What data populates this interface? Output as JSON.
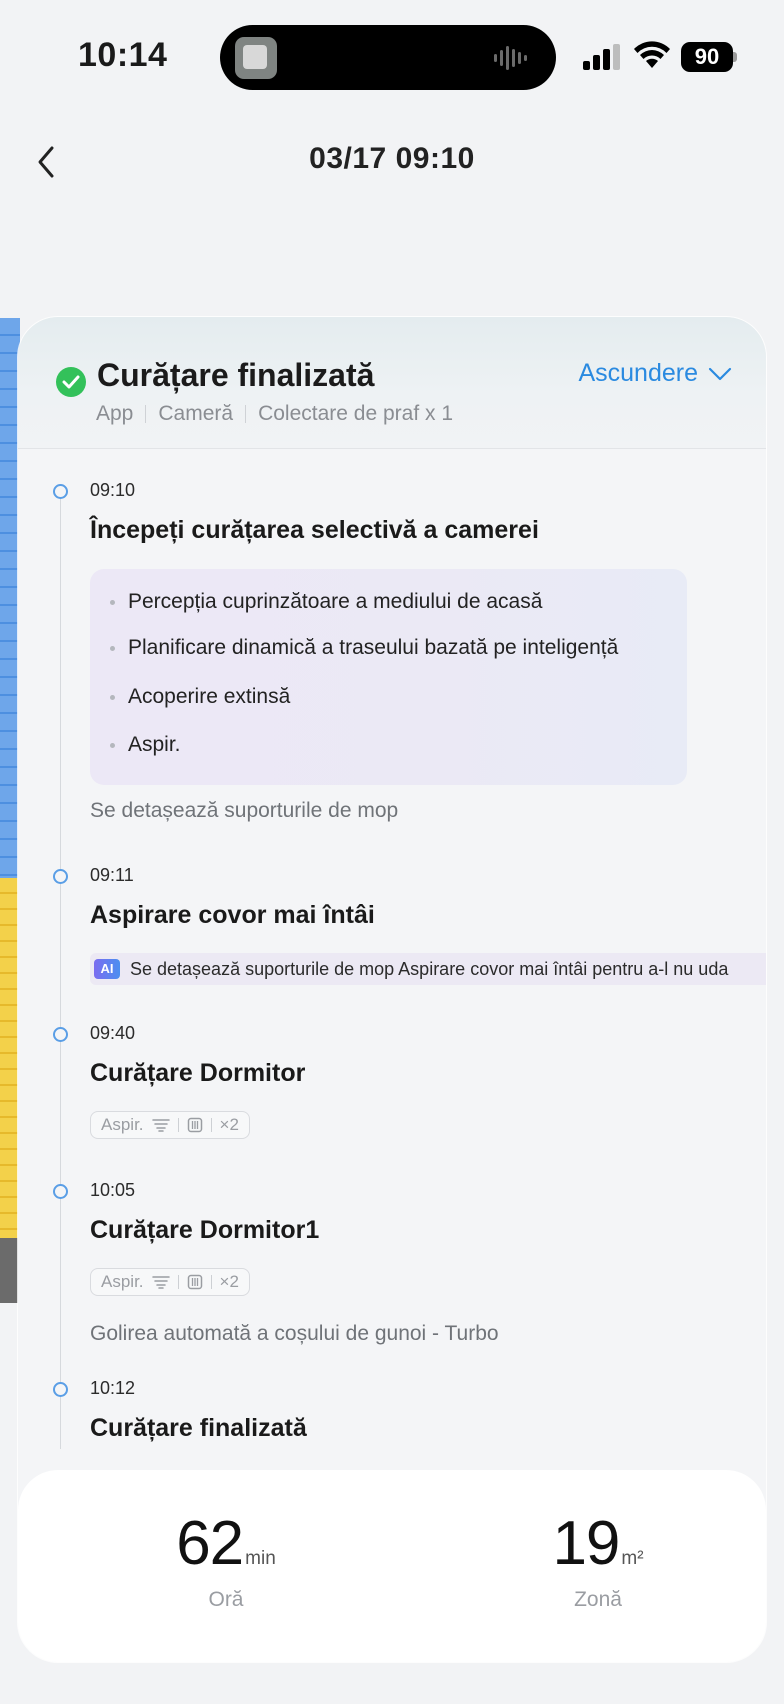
{
  "status_bar": {
    "time": "10:14",
    "battery": "90"
  },
  "nav": {
    "title": "03/17  09:10"
  },
  "summary": {
    "title": "Curățare finalizată",
    "toggle_label": "Ascundere",
    "tags": [
      "App",
      "Cameră",
      "Colectare de praf x 1"
    ],
    "status_color": "#33c15a",
    "accent_color": "#2a8ae0"
  },
  "events": [
    {
      "time": "09:10",
      "title": "Începeți curățarea selectivă a camerei",
      "bullets": [
        "Percepția cuprinzătoare a mediului de acasă",
        "Planificare dinamică a traseului bazată pe inteligență",
        "Acoperire extinsă",
        "Aspir."
      ],
      "note": "Se detașează suporturile de mop"
    },
    {
      "time": "09:11",
      "title": "Aspirare covor mai întâi",
      "ai_badge": "AI",
      "ai_text": "Se detașează suporturile de mop Aspirare covor mai întâi pentru a-l nu uda"
    },
    {
      "time": "09:40",
      "title": "Curățare Dormitor",
      "chip": {
        "mode": "Aspir.",
        "passes": "×2",
        "icons": [
          "suction-icon",
          "mop-pad-icon"
        ]
      }
    },
    {
      "time": "10:05",
      "title": "Curățare Dormitor1",
      "chip": {
        "mode": "Aspir.",
        "passes": "×2",
        "icons": [
          "suction-icon",
          "mop-pad-icon"
        ]
      },
      "note": "Golirea automată a coșului de gunoi - Turbo"
    },
    {
      "time": "10:12",
      "title": "Curățare finalizată"
    }
  ],
  "stats": {
    "duration": {
      "value": "62",
      "unit": "min",
      "label": "Oră"
    },
    "area": {
      "value": "19",
      "unit": "m²",
      "label": "Zonă"
    }
  }
}
